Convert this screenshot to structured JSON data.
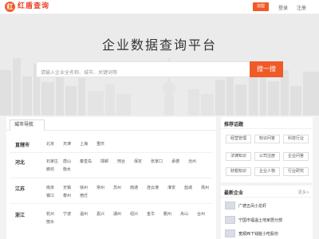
{
  "header": {
    "logo_mark": "红",
    "logo_text": "红盾查询",
    "join_label": "加盟",
    "login_label": "登录",
    "register_label": "注册"
  },
  "hero": {
    "title": "企业数据查询平台",
    "search_placeholder": "请输入企业全名称、城市、关键词等",
    "search_button": "搜一搜"
  },
  "city_nav": {
    "tab_label": "城市导航",
    "regions": [
      {
        "name": "直辖市",
        "cities": [
          "北京",
          "天津",
          "上海",
          "重庆"
        ]
      },
      {
        "name": "河北",
        "cities": [
          "石家庄",
          "唐山",
          "秦皇岛",
          "邯郸",
          "邢台",
          "保定",
          "张家口",
          "承德",
          "沧州",
          "廊坊",
          "衡水"
        ]
      },
      {
        "name": "江苏",
        "cities": [
          "南京",
          "无锡",
          "徐州",
          "常州",
          "苏州",
          "南通",
          "连云港",
          "淮安",
          "盐城",
          "扬州",
          "镇江",
          "泰州",
          "宿迁"
        ]
      },
      {
        "name": "浙江",
        "cities": [
          "杭州",
          "宁波",
          "温州",
          "嘉兴",
          "湖州",
          "绍兴",
          "金华",
          "衢州",
          "舟山",
          "台州",
          "丽水"
        ]
      }
    ]
  },
  "topics": {
    "title": "推荐话题",
    "tags": [
      "经营管理",
      "知识问答",
      "科技行业",
      "法律知识",
      "公司注册",
      "企业问答",
      "财税知识",
      "企业人物",
      "行业研究"
    ]
  },
  "news": {
    "title": "最新企业",
    "more": "更多>",
    "items": [
      {
        "text": "广德五凤小龙虾"
      },
      {
        "text": "宁国市福温土地家居分部"
      },
      {
        "text": "宽顺西下钱脏小吃股份"
      }
    ]
  },
  "colors": {
    "brand": "#f05a28"
  }
}
